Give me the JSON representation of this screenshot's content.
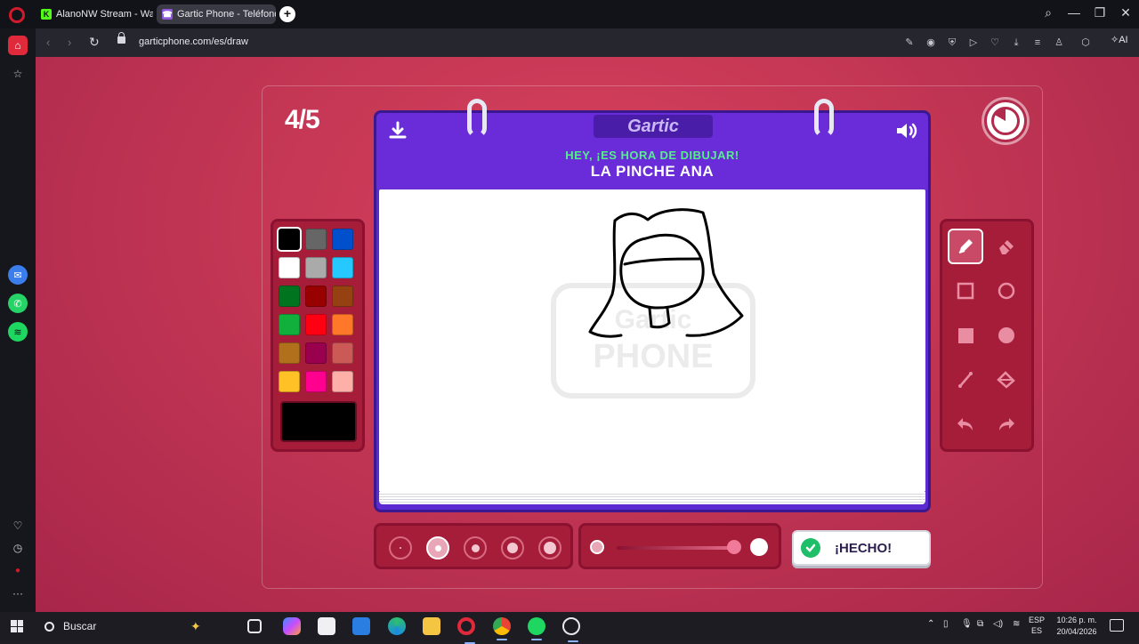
{
  "browser": {
    "tabs": [
      {
        "label": "AlanoNW Stream - Watch",
        "icon": "kick-icon"
      },
      {
        "label": "Gartic Phone - Teléfono D",
        "icon": "gartic-icon",
        "active": true
      }
    ],
    "url": "garticphone.com/es/draw",
    "ai_label": "AI"
  },
  "game": {
    "round": "4/5",
    "logo": "Gartic",
    "prompt_sub": "HEY, ¡ES HORA DE DIBUJAR!",
    "prompt_main": "LA PINCHE ANA",
    "watermark_1": "Gartic",
    "watermark_2": "PHONE",
    "palette": [
      "#000000",
      "#666666",
      "#0050cd",
      "#ffffff",
      "#aaaaaa",
      "#26c9ff",
      "#017420",
      "#990000",
      "#964112",
      "#11b03c",
      "#ff0013",
      "#ff7829",
      "#b0701c",
      "#99004e",
      "#cb5a57",
      "#ffc126",
      "#ff008f",
      "#feafa8"
    ],
    "selected_color": "#000000",
    "tools": [
      "pencil-icon",
      "eraser-icon",
      "rectangle-outline-icon",
      "ellipse-outline-icon",
      "rectangle-filled-icon",
      "ellipse-filled-icon",
      "line-icon",
      "fill-bucket-icon",
      "undo-icon",
      "redo-icon"
    ],
    "active_tool": "pencil-icon",
    "brush_sizes": 5,
    "selected_size_index": 1,
    "done_label": "¡HECHO!"
  },
  "taskbar": {
    "search_placeholder": "Buscar",
    "lang_1": "ESP",
    "lang_2": "ES",
    "time": "10:26 p. m.",
    "date": "20/04/2026"
  }
}
